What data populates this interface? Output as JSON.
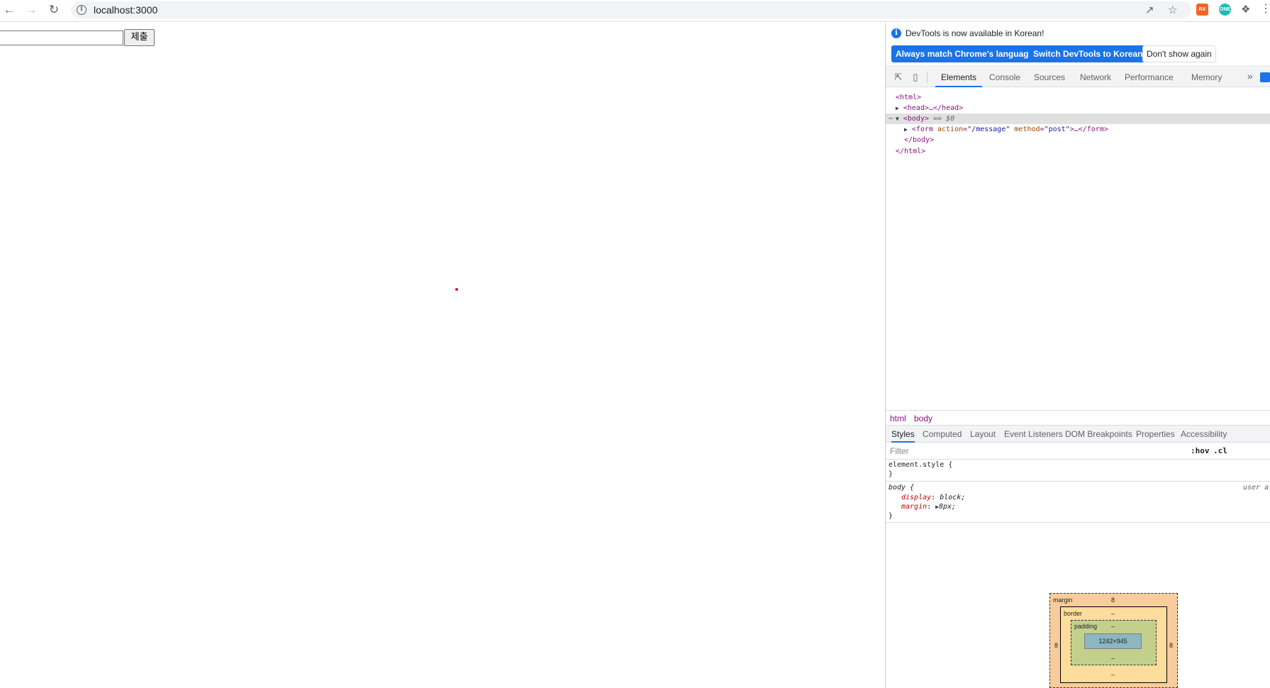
{
  "browser": {
    "url": "localhost:3000",
    "extensions": [
      {
        "name": "rx-extension",
        "label": "RX",
        "color": "#f26522"
      },
      {
        "name": "one-extension",
        "label": "ONE",
        "color": "#1fbcb4"
      }
    ]
  },
  "page": {
    "submit_label": "제출",
    "input_value": ""
  },
  "devtools": {
    "infobar": {
      "message": "DevTools is now available in Korean!",
      "btn_match": "Always match Chrome's language",
      "btn_switch": "Switch DevTools to Korean",
      "btn_dismiss": "Don't show again"
    },
    "tabs": [
      "Elements",
      "Console",
      "Sources",
      "Network",
      "Performance",
      "Memory"
    ],
    "dom": {
      "html_open": "<html>",
      "head": "<head>…</head>",
      "body_open": "<body>",
      "body_marker": "== $0",
      "form_tag": "<form",
      "form_attr1_name": "action",
      "form_attr1_val": "\"/message\"",
      "form_attr2_name": "method",
      "form_attr2_val": "\"post\"",
      "form_close": ">…</form>",
      "body_close": "</body>",
      "html_close": "</html>"
    },
    "breadcrumbs": [
      "html",
      "body"
    ],
    "styles_tabs": [
      "Styles",
      "Computed",
      "Layout",
      "Event Listeners",
      "DOM Breakpoints",
      "Properties",
      "Accessibility"
    ],
    "filter_placeholder": "Filter",
    "filter_hov": ":hov",
    "filter_cls": ".cl",
    "rules": {
      "element_style_open": "element.style {",
      "close": "}",
      "body_selector": "body {",
      "ua_label": "user a",
      "prop1_name": "display",
      "prop1_value": "block;",
      "prop2_name": "margin",
      "prop2_value": "8px;"
    },
    "box_model": {
      "margin_label": "margin",
      "margin_top": "8",
      "margin_left": "8",
      "margin_right": "8",
      "margin_bottom": "–",
      "border_label": "border",
      "border_val": "–",
      "padding_label": "padding",
      "padding_val": "–",
      "content_size": "1242×945"
    }
  }
}
